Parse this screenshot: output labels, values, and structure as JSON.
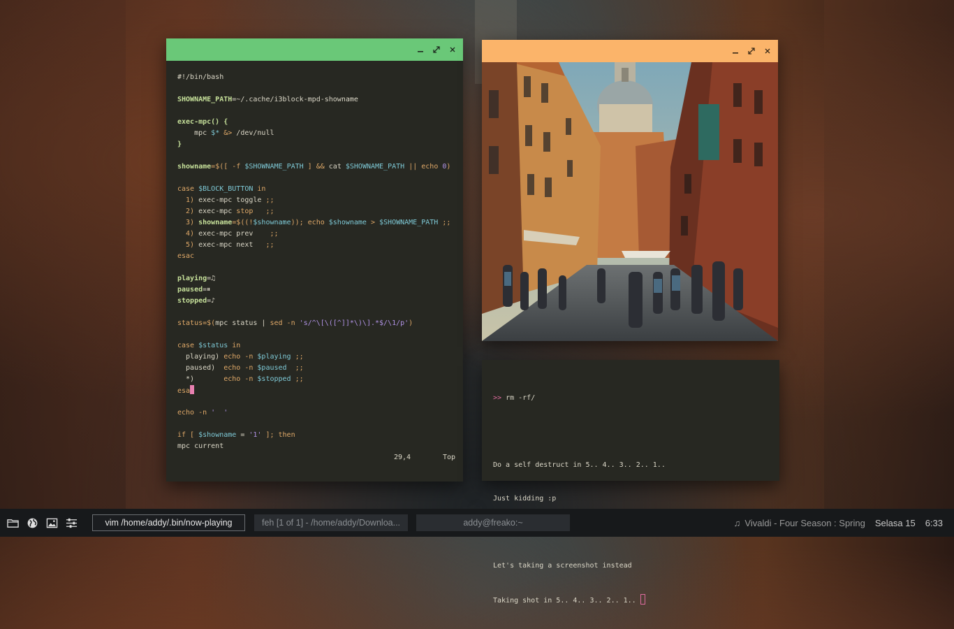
{
  "vim": {
    "code_lines": [
      [
        {
          "t": "#!/bin/bash",
          "c": ""
        }
      ],
      [],
      [
        {
          "t": "SHOWNAME_PATH",
          "c": "b"
        },
        {
          "t": "=~/.cache/i3block-mpd-showname",
          "c": ""
        }
      ],
      [],
      [
        {
          "t": "exec-mpc() {",
          "c": "b"
        }
      ],
      [
        {
          "t": "    mpc ",
          "c": ""
        },
        {
          "t": "$*",
          "c": "v"
        },
        {
          "t": " &>",
          "c": "op"
        },
        {
          "t": " /dev/null",
          "c": ""
        }
      ],
      [
        {
          "t": "}",
          "c": "b"
        }
      ],
      [],
      [
        {
          "t": "showname",
          "c": "b"
        },
        {
          "t": "=$([",
          "c": "op"
        },
        {
          "t": " -f ",
          "c": "k"
        },
        {
          "t": "$SHOWNAME_PATH",
          "c": "v"
        },
        {
          "t": " ] && ",
          "c": "op"
        },
        {
          "t": "cat ",
          "c": ""
        },
        {
          "t": "$SHOWNAME_PATH",
          "c": "v"
        },
        {
          "t": " || echo ",
          "c": "k"
        },
        {
          "t": "0",
          "c": "c"
        },
        {
          "t": ")",
          "c": "op"
        }
      ],
      [],
      [
        {
          "t": "case ",
          "c": "k"
        },
        {
          "t": "$BLOCK_BUTTON",
          "c": "v"
        },
        {
          "t": " in",
          "c": "k"
        }
      ],
      [
        {
          "t": "  1) ",
          "c": "k"
        },
        {
          "t": "exec-mpc toggle ",
          "c": ""
        },
        {
          "t": ";;",
          "c": "k"
        }
      ],
      [
        {
          "t": "  2) ",
          "c": "k"
        },
        {
          "t": "exec-mpc ",
          "c": ""
        },
        {
          "t": "stop",
          "c": "k"
        },
        {
          "t": "   ;;",
          "c": "k"
        }
      ],
      [
        {
          "t": "  3) ",
          "c": "k"
        },
        {
          "t": "showname",
          "c": "b"
        },
        {
          "t": "=$((!",
          "c": "op"
        },
        {
          "t": "$showname",
          "c": "v"
        },
        {
          "t": ")); echo ",
          "c": "k"
        },
        {
          "t": "$showname",
          "c": "v"
        },
        {
          "t": " > ",
          "c": "op"
        },
        {
          "t": "$SHOWNAME_PATH",
          "c": "v"
        },
        {
          "t": " ;;",
          "c": "k"
        }
      ],
      [
        {
          "t": "  4) ",
          "c": "k"
        },
        {
          "t": "exec-mpc prev    ",
          "c": ""
        },
        {
          "t": ";;",
          "c": "k"
        }
      ],
      [
        {
          "t": "  5) ",
          "c": "k"
        },
        {
          "t": "exec-mpc next   ",
          "c": ""
        },
        {
          "t": ";;",
          "c": "k"
        }
      ],
      [
        {
          "t": "esac",
          "c": "k"
        }
      ],
      [],
      [
        {
          "t": "playing",
          "c": "b"
        },
        {
          "t": "=♫",
          "c": ""
        }
      ],
      [
        {
          "t": "paused",
          "c": "b"
        },
        {
          "t": "=⏸",
          "c": ""
        }
      ],
      [
        {
          "t": "stopped",
          "c": "b"
        },
        {
          "t": "=♪",
          "c": ""
        }
      ],
      [],
      [
        {
          "t": "status",
          "c": "k"
        },
        {
          "t": "=$(",
          "c": "op"
        },
        {
          "t": "mpc status | ",
          "c": ""
        },
        {
          "t": "sed -n ",
          "c": "k"
        },
        {
          "t": "'s/^\\[\\([^]]*\\)\\].*$/\\1/p'",
          "c": "c"
        },
        {
          "t": ")",
          "c": "op"
        }
      ],
      [],
      [
        {
          "t": "case ",
          "c": "k"
        },
        {
          "t": "$status",
          "c": "v"
        },
        {
          "t": " in",
          "c": "k"
        }
      ],
      [
        {
          "t": "  playing) ",
          "c": ""
        },
        {
          "t": "echo -n ",
          "c": "k"
        },
        {
          "t": "$playing",
          "c": "v"
        },
        {
          "t": " ;;",
          "c": "k"
        }
      ],
      [
        {
          "t": "  paused)  ",
          "c": ""
        },
        {
          "t": "echo -n ",
          "c": "k"
        },
        {
          "t": "$paused",
          "c": "v"
        },
        {
          "t": "  ;;",
          "c": "k"
        }
      ],
      [
        {
          "t": "  *)       ",
          "c": ""
        },
        {
          "t": "echo -n ",
          "c": "k"
        },
        {
          "t": "$stopped",
          "c": "v"
        },
        {
          "t": " ;;",
          "c": "k"
        }
      ],
      [
        {
          "t": "esa",
          "c": "k"
        },
        {
          "t": "",
          "c": "cursor"
        }
      ],
      [],
      [
        {
          "t": "echo -n ",
          "c": "k"
        },
        {
          "t": "'  '",
          "c": "c"
        }
      ],
      [],
      [
        {
          "t": "if [ ",
          "c": "k"
        },
        {
          "t": "$showname",
          "c": "v"
        },
        {
          "t": " = ",
          "c": ""
        },
        {
          "t": "'1'",
          "c": "c"
        },
        {
          "t": " ]; then",
          "c": "k"
        }
      ],
      [
        {
          "t": "mpc current",
          "c": ""
        }
      ]
    ],
    "cursor_position": "29,4",
    "scroll_position": "Top"
  },
  "terminal": {
    "prompt": ">>",
    "command": "rm -rf/",
    "output_lines": [
      "Do a self destruct in 5.. 4.. 3.. 2.. 1..",
      "Just kidding :p",
      "",
      "Let's taking a screenshot instead",
      "Taking shot in 5.. 4.. 3.. 2.. 1.. "
    ]
  },
  "taskbar": {
    "icons": [
      "folder-icon",
      "globe-icon",
      "image-icon",
      "sliders-icon"
    ],
    "tasks": [
      {
        "label": "vim /home/addy/.bin/now-playing",
        "active": true
      },
      {
        "label": "feh [1 of 1] - /home/addy/Downloa...",
        "active": false
      },
      {
        "label": "addy@freako:~",
        "active": false
      }
    ],
    "now_playing": "Vivaldi - Four Season : Spring",
    "date": "Selasa 15",
    "time": "6:33"
  },
  "colors": {
    "vim_titlebar": "#6ac878",
    "feh_titlebar": "#fbb46a",
    "window_bg": "#272822",
    "taskbar_bg": "#17191b",
    "prompt": "#e06c9f"
  }
}
